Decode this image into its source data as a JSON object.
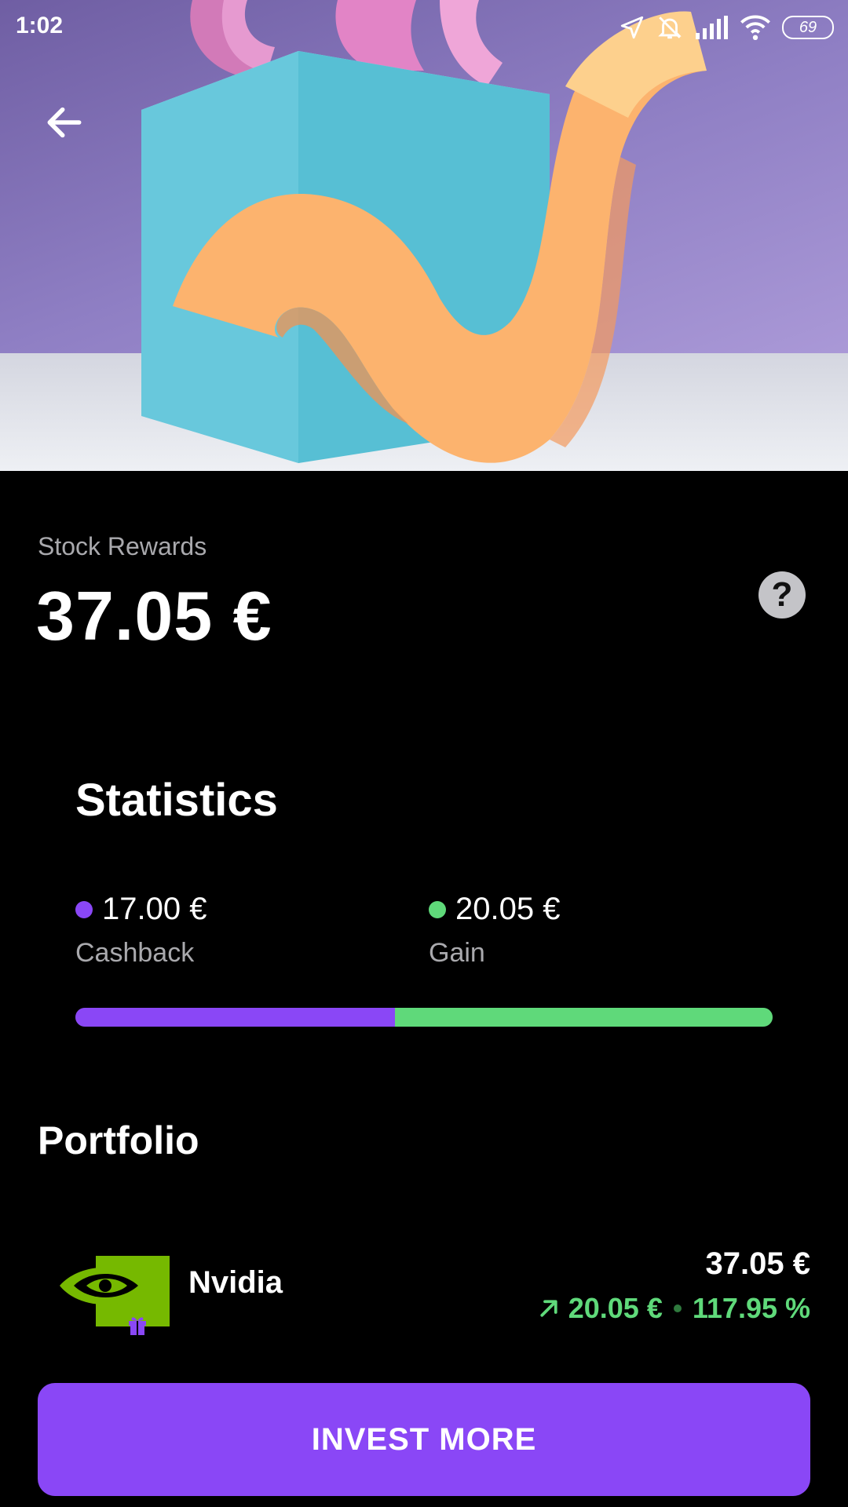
{
  "status_bar": {
    "time": "1:02",
    "battery": "69",
    "icons": [
      "location-icon",
      "bell-off-icon",
      "signal-icon",
      "wifi-icon",
      "battery-icon"
    ]
  },
  "header": {
    "back_icon": "arrow-left-icon"
  },
  "rewards": {
    "label": "Stock Rewards",
    "amount": "37.05 €",
    "help_symbol": "?"
  },
  "statistics": {
    "title": "Statistics",
    "items": [
      {
        "value": "17.00 €",
        "label": "Cashback",
        "color": "#8a47f6"
      },
      {
        "value": "20.05 €",
        "label": "Gain",
        "color": "#5fd97a"
      }
    ],
    "progress_fractions": [
      0.458,
      0.542
    ]
  },
  "portfolio": {
    "title": "Portfolio",
    "holdings": [
      {
        "name": "Nvidia",
        "value": "37.05 €",
        "gain_amount": "20.05 €",
        "gain_percent": "117.95 %",
        "trend_icon": "arrow-up-right-icon",
        "badge_icon": "gift-icon",
        "logo_color": "#76b900"
      }
    ]
  },
  "cta": {
    "label": "INVEST MORE",
    "color": "#8a47f6"
  }
}
